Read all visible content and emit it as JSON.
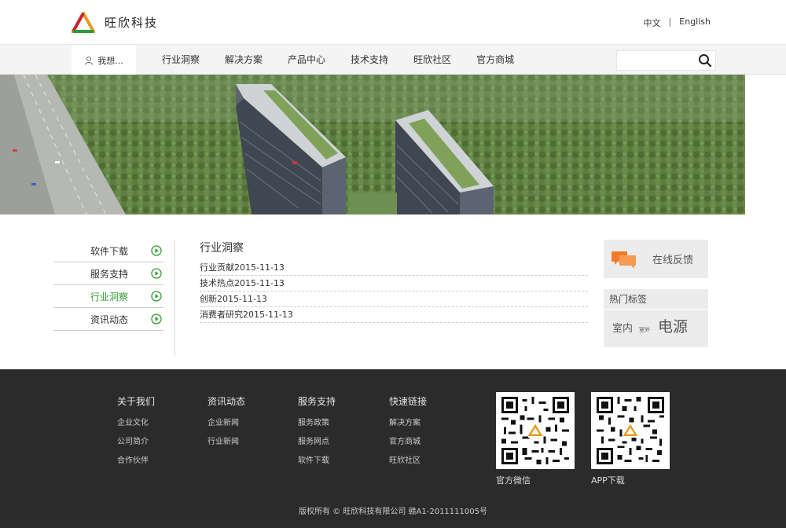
{
  "header": {
    "logo_text": "旺欣科技",
    "lang_zh": "中文",
    "lang_sep": "|",
    "lang_en": "English"
  },
  "nav": {
    "want_label": "我想...",
    "items": [
      "行业洞察",
      "解决方案",
      "产品中心",
      "技术支持",
      "旺欣社区",
      "官方商城"
    ],
    "search_placeholder": ""
  },
  "sidebar": {
    "items": [
      "软件下载",
      "服务支持",
      "行业洞察",
      "资讯动态"
    ],
    "active_index": 2
  },
  "content": {
    "title": "行业洞察",
    "news": [
      "行业贡献2015-11-13",
      "技术热点2015-11-13",
      "创新2015-11-13",
      "消费者研究2015-11-13"
    ]
  },
  "feedback": {
    "label": "在线反馈"
  },
  "tags": {
    "title": "热门标签",
    "items": [
      "室内",
      "室外",
      "电源"
    ]
  },
  "footer": {
    "columns": [
      {
        "title": "关于我们",
        "links": [
          "企业文化",
          "公司简介",
          "合作伙伴"
        ]
      },
      {
        "title": "资讯动态",
        "links": [
          "企业新闻",
          "行业新闻"
        ]
      },
      {
        "title": "服务支持",
        "links": [
          "服务政策",
          "服务网点",
          "软件下载"
        ]
      },
      {
        "title": "快速链接",
        "links": [
          "解决方案",
          "官方商城",
          "旺欣社区"
        ]
      }
    ],
    "qr": [
      {
        "label": "官方微信"
      },
      {
        "label": "APP下载"
      }
    ],
    "copyright": "版权所有 © 旺欣科技有限公司 赣A1-2011111005号"
  },
  "colors": {
    "accent_green": "#2f9a34",
    "feedback_orange": "#f07a28",
    "footer_bg": "#2b2b2b"
  }
}
